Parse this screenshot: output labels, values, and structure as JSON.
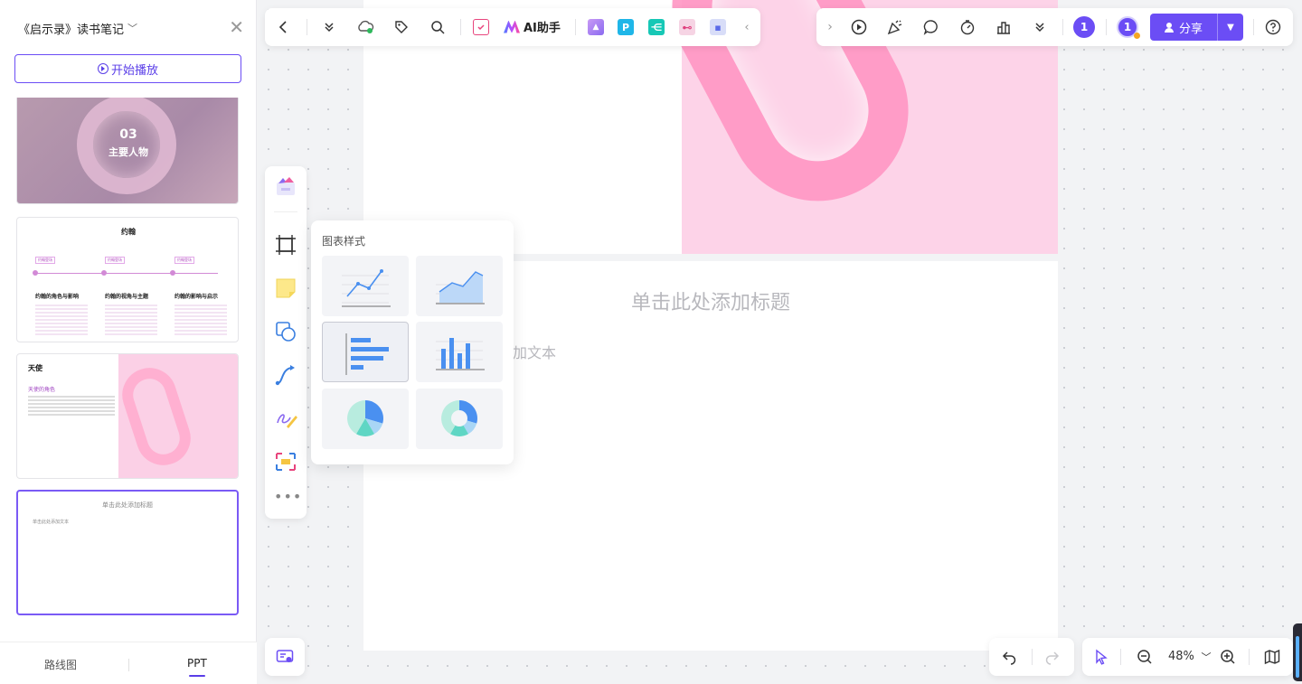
{
  "app": {
    "doc_title": "《启示录》读书笔记",
    "start_play_label": "开始播放"
  },
  "thumbnails": [
    {
      "number": "03",
      "label": "主要人物"
    },
    {
      "title": "约翰",
      "tags": [
        "约翰登场",
        "约翰登场",
        "约翰登场"
      ],
      "columns": [
        "约翰的角色与影响",
        "约翰的视角与主题",
        "约翰的影响与启示"
      ]
    },
    {
      "title": "天使",
      "subtitle": "天使的角色"
    },
    {
      "title": "单击此处添加标题",
      "body": "单击此处添加文本"
    }
  ],
  "left_footer": {
    "tab_roadmap": "路线图",
    "tab_ppt": "PPT"
  },
  "toolbar": {
    "ai_label": "AI助手",
    "collab_count_1": "1",
    "collab_count_2": "1",
    "share_label": "分享"
  },
  "slide": {
    "title_placeholder": "单击此处添加标题",
    "body_placeholder": "加文本"
  },
  "chart_popup": {
    "title": "图表样式",
    "options": [
      "line",
      "area",
      "bar-horizontal",
      "bar-vertical",
      "pie",
      "donut"
    ],
    "selected": "bar-horizontal"
  },
  "zoom": {
    "value": "48%"
  },
  "colors": {
    "accent": "#6b4df5",
    "chart_blue": "#4a90f0",
    "chart_teal": "#5fd6c4",
    "chart_light": "#a9d6f5"
  }
}
